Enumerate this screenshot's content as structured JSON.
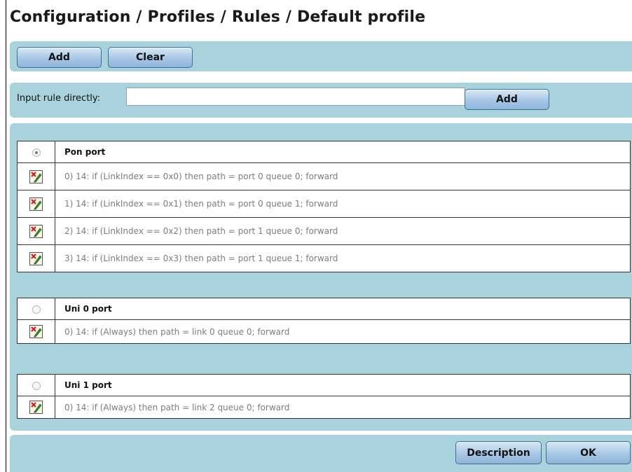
{
  "page": {
    "title": "Configuration / Profiles / Rules / Default profile"
  },
  "toolbar": {
    "add_label": "Add",
    "clear_label": "Clear"
  },
  "direct_input": {
    "label": "Input rule directly:",
    "value": "",
    "add_label": "Add"
  },
  "ports": [
    {
      "name": "Pon port",
      "selected": true,
      "rules": [
        "0) 14: if (LinkIndex == 0x0) then path = port 0 queue 0; forward",
        "1) 14: if (LinkIndex == 0x1) then path = port 0 queue 1; forward",
        "2) 14: if (LinkIndex == 0x2) then path = port 1 queue 0; forward",
        "3) 14: if (LinkIndex == 0x3) then path = port 1 queue 1; forward"
      ]
    },
    {
      "name": "Uni 0 port",
      "selected": false,
      "rules": [
        "0) 14: if (Always) then path = link 0 queue 0; forward"
      ]
    },
    {
      "name": "Uni 1 port",
      "selected": false,
      "rules": [
        "0) 14: if (Always) then path = link 2 queue 0; forward"
      ]
    }
  ],
  "footer": {
    "description_label": "Description",
    "ok_label": "OK"
  },
  "colors": {
    "panel_bg": "#a8d3dc",
    "button_top": "#d7e8f6",
    "button_bottom": "#8db5da",
    "rule_text": "#7d7d7d"
  },
  "icons": {
    "rule_edit": "edit-rule-icon",
    "port_select": "radio-icon"
  }
}
